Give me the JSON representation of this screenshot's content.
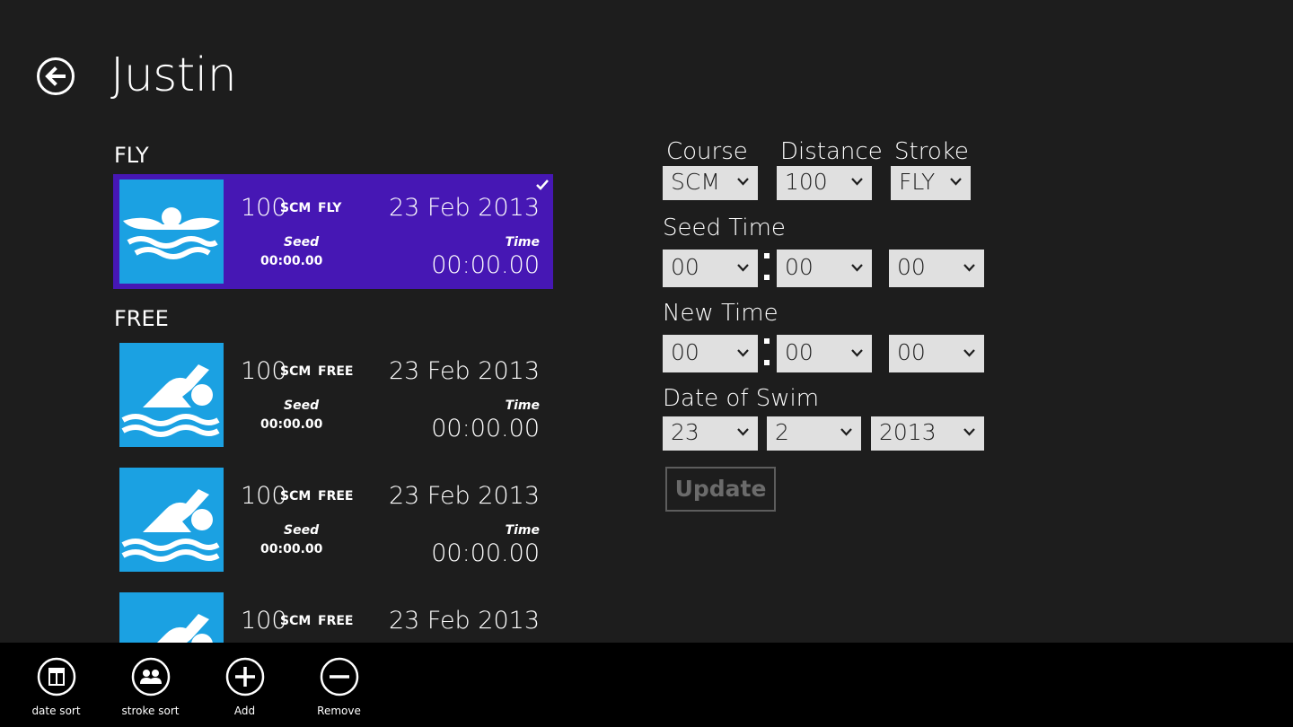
{
  "page": {
    "title": "Justin"
  },
  "groups": [
    {
      "header": "FLY",
      "items": [
        {
          "distance": "100",
          "course": "SCM",
          "stroke": "FLY",
          "date": "23 Feb 2013",
          "seed_label": "Seed",
          "seed_time": "00:00.00",
          "time_label": "Time",
          "time": "00:00.00",
          "icon": "butterfly-swimmer-icon",
          "selected": true
        }
      ]
    },
    {
      "header": "FREE",
      "items": [
        {
          "distance": "100",
          "course": "SCM",
          "stroke": "FREE",
          "date": "23 Feb 2013",
          "seed_label": "Seed",
          "seed_time": "00:00.00",
          "time_label": "Time",
          "time": "00:00.00",
          "icon": "freestyle-swimmer-icon",
          "selected": false
        },
        {
          "distance": "100",
          "course": "SCM",
          "stroke": "FREE",
          "date": "23 Feb 2013",
          "seed_label": "Seed",
          "seed_time": "00:00.00",
          "time_label": "Time",
          "time": "00:00.00",
          "icon": "freestyle-swimmer-icon",
          "selected": false
        },
        {
          "distance": "100",
          "course": "SCM",
          "stroke": "FREE",
          "date": "23 Feb 2013",
          "icon": "freestyle-swimmer-icon",
          "selected": false
        }
      ]
    }
  ],
  "form": {
    "course_label": "Course",
    "course_value": "SCM",
    "distance_label": "Distance",
    "distance_value": "100",
    "stroke_label": "Stroke",
    "stroke_value": "FLY",
    "seed_label": "Seed Time",
    "seed_min": "00",
    "seed_sec": "00",
    "seed_hund": "00",
    "new_label": "New Time",
    "new_min": "00",
    "new_sec": "00",
    "new_hund": "00",
    "date_label": "Date of Swim",
    "day": "23",
    "month": "2",
    "year": "2013",
    "update_label": "Update"
  },
  "appbar": {
    "date_sort": "date sort",
    "stroke_sort": "stroke sort",
    "add": "Add",
    "remove": "Remove"
  },
  "colors": {
    "background": "#1d1d1d",
    "accent": "#4617b4",
    "tile": "#1ba1e2",
    "appbar": "#000000"
  }
}
